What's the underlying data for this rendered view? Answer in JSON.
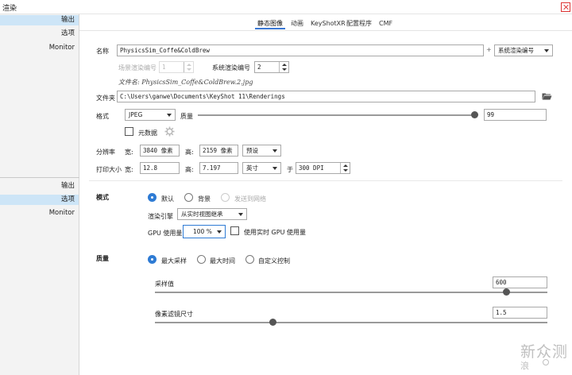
{
  "window": {
    "title": "渲染"
  },
  "sidebar_top": [
    "输出",
    "选项",
    "Monitor"
  ],
  "sidebar_bottom": [
    "输出",
    "选项",
    "Monitor"
  ],
  "tabs": [
    "静态图像",
    "动画",
    "KeyShotXR",
    "配置程序",
    "CMF"
  ],
  "output": {
    "name_label": "名称",
    "name_value": "PhysicsSim_Coffe&ColdBrew",
    "plus": "+",
    "name_suffix_select": "系统渲染编号",
    "scene_number_label": "场景渲染编号",
    "scene_number_value": "1",
    "system_number_label": "系统渲染编号",
    "system_number_value": "2",
    "filename_preview": "文件名: PhysicsSim_Coffe&ColdBrew.2.jpg",
    "folder_label": "文件夹",
    "folder_value": "C:\\Users\\ganwe\\Documents\\KeyShot 11\\Renderings",
    "format_label": "格式",
    "format_value": "JPEG",
    "quality_label": "质量",
    "quality_value": "99",
    "quality_fraction": 0.99,
    "metadata_label": "元数据",
    "resolution_label": "分辨率",
    "width_label": "宽:",
    "width_value": "3840 像素",
    "height_label": "高:",
    "height_value": "2159 像素",
    "preset_label": "预设",
    "print_size_label": "打印大小",
    "print_width_label": "宽:",
    "print_width_value": "12.8",
    "print_height_label": "高:",
    "print_height_value": "7.197",
    "unit_value": "英寸",
    "at_label": "于",
    "dpi_value": "300 DPI"
  },
  "mode": {
    "title": "模式",
    "options": [
      "默认",
      "背景",
      "发送到网络"
    ],
    "engine_label": "渲染引擎",
    "engine_value": "从实时视图继承",
    "gpu_label": "GPU 使用量",
    "gpu_value": "100 %",
    "gpu_realtime_label": "使用实时 GPU 使用量"
  },
  "quality": {
    "title": "质量",
    "options": [
      "最大采样",
      "最大时间",
      "自定义控制"
    ],
    "samples_label": "采样值",
    "samples_value": "600",
    "samples_fraction": 0.895,
    "pixel_filter_label": "像素滤镜尺寸",
    "pixel_filter_value": "1.5",
    "pixel_filter_fraction": 0.3
  },
  "watermark": {
    "text_a": "新",
    "text_b": "浪",
    "text_c": "众测"
  },
  "colors": {
    "accent": "#2e7bd4",
    "selection": "#cde5f7"
  }
}
